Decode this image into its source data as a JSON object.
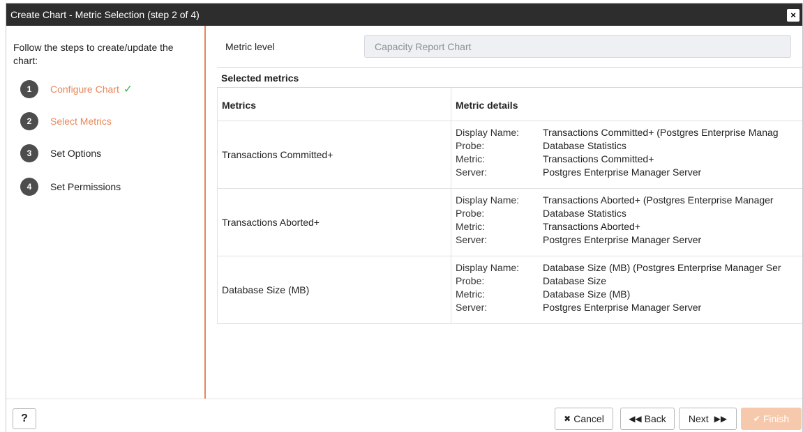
{
  "dialog": {
    "title": "Create Chart - Metric Selection (step 2 of 4)",
    "close_icon": "×"
  },
  "sidebar": {
    "intro": "Follow the steps to create/update the chart:",
    "steps": [
      {
        "number": "1",
        "label": "Configure Chart",
        "state": "done",
        "check": "✓"
      },
      {
        "number": "2",
        "label": "Select Metrics",
        "state": "active"
      },
      {
        "number": "3",
        "label": "Set Options",
        "state": "pending"
      },
      {
        "number": "4",
        "label": "Set Permissions",
        "state": "pending"
      }
    ]
  },
  "main": {
    "metric_level_label": "Metric level",
    "metric_level_value": "Capacity Report Chart",
    "selected_header": "Selected metrics",
    "columns": [
      "Metrics",
      "Metric details"
    ],
    "rows": [
      {
        "metric": "Transactions Committed+",
        "details": [
          {
            "key": "Display Name:",
            "value": "Transactions Committed+ (Postgres Enterprise Manag"
          },
          {
            "key": "Probe:",
            "value": "Database Statistics"
          },
          {
            "key": "Metric:",
            "value": "Transactions Committed+"
          },
          {
            "key": "Server:",
            "value": "Postgres Enterprise Manager Server"
          }
        ]
      },
      {
        "metric": "Transactions Aborted+",
        "details": [
          {
            "key": "Display Name:",
            "value": "Transactions Aborted+ (Postgres Enterprise Manager"
          },
          {
            "key": "Probe:",
            "value": "Database Statistics"
          },
          {
            "key": "Metric:",
            "value": "Transactions Aborted+"
          },
          {
            "key": "Server:",
            "value": "Postgres Enterprise Manager Server"
          }
        ]
      },
      {
        "metric": "Database Size (MB)",
        "details": [
          {
            "key": "Display Name:",
            "value": "Database Size (MB) (Postgres Enterprise Manager Ser"
          },
          {
            "key": "Probe:",
            "value": "Database Size"
          },
          {
            "key": "Metric:",
            "value": "Database Size (MB)"
          },
          {
            "key": "Server:",
            "value": "Postgres Enterprise Manager Server"
          }
        ]
      }
    ]
  },
  "footer": {
    "help_label": "?",
    "cancel_icon": "✖",
    "cancel_label": "Cancel",
    "back_icon": "◀◀",
    "back_label": "Back",
    "next_label": "Next",
    "next_icon": "▶▶",
    "finish_icon": "✔",
    "finish_label": "Finish"
  },
  "colors": {
    "accent": "#e8875a",
    "check": "#3fb34f",
    "titlebar": "#2d2d2d",
    "finish_disabled": "#f6c9ad"
  }
}
